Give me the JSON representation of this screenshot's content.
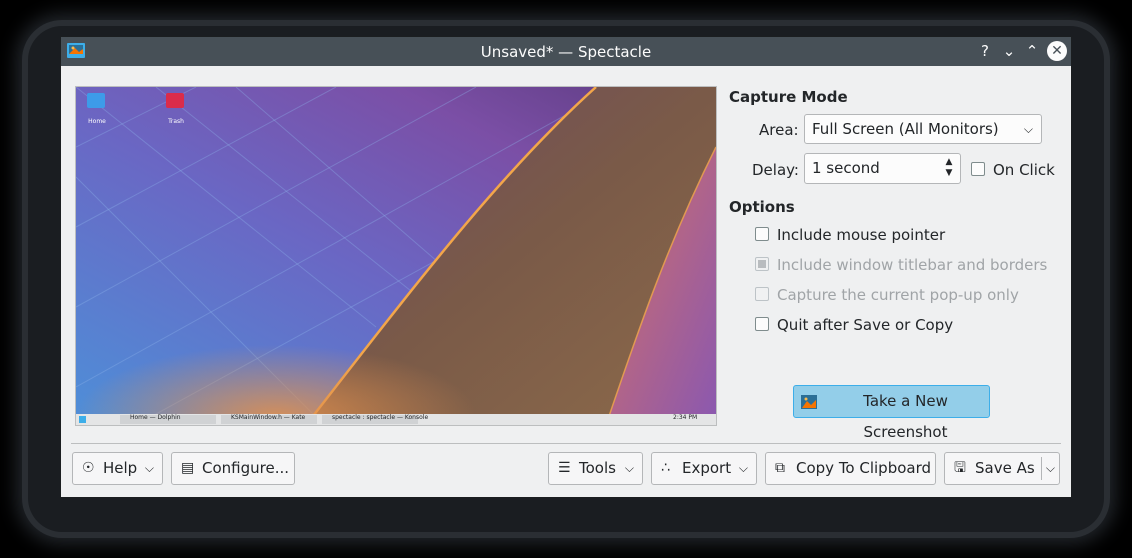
{
  "window": {
    "title": "Unsaved* — Spectacle",
    "help_glyph": "?",
    "minimize_glyph": "⌄",
    "maximize_glyph": "⌃",
    "close_glyph": "✕"
  },
  "preview": {
    "desktop_icons": [
      {
        "label": "Home",
        "icon": "home-folder-icon"
      },
      {
        "label": "Trash",
        "icon": "trash-icon"
      }
    ],
    "taskbar": {
      "tasks": [
        "Home — Dolphin",
        "KSMainWindow.h — Kate",
        "spectacle : spectacle — Konsole"
      ],
      "clock": "2:34 PM"
    }
  },
  "capture_mode": {
    "title": "Capture Mode",
    "area_label": "Area:",
    "area_value": "Full Screen (All Monitors)",
    "delay_label": "Delay:",
    "delay_value": "1 second",
    "on_click_label": "On Click"
  },
  "options": {
    "title": "Options",
    "items": [
      {
        "label": "Include mouse pointer",
        "enabled": true,
        "checked": false
      },
      {
        "label": "Include window titlebar and borders",
        "enabled": false,
        "checked": true
      },
      {
        "label": "Capture the current pop-up only",
        "enabled": false,
        "checked": false
      },
      {
        "label": "Quit after Save or Copy",
        "enabled": true,
        "checked": false
      }
    ]
  },
  "take_screenshot_label": "Take a New Screenshot",
  "footer": {
    "help_label": "Help",
    "configure_label": "Configure...",
    "tools_label": "Tools",
    "export_label": "Export",
    "copy_label": "Copy To Clipboard",
    "save_as_label": "Save As"
  },
  "colors": {
    "titlebar": "#475057",
    "window_bg": "#eff0f1",
    "accent": "#3daee9",
    "accent_fill": "#93cee9"
  }
}
